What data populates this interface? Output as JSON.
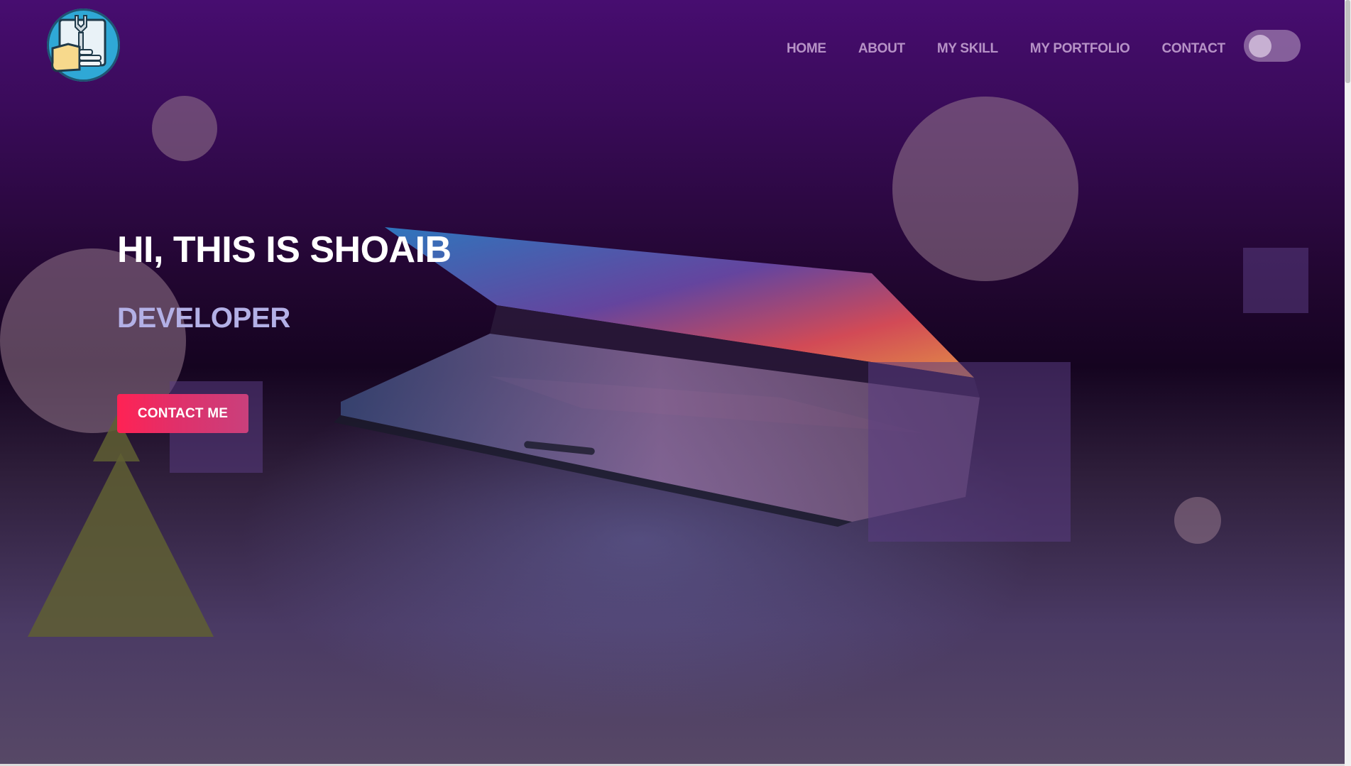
{
  "header": {
    "logo_icon": "wrench-hand-logo-icon",
    "nav": [
      {
        "label": "HOME"
      },
      {
        "label": "ABOUT"
      },
      {
        "label": "MY SKILL"
      },
      {
        "label": "MY PORTFOLIO"
      },
      {
        "label": "CONTACT"
      }
    ],
    "theme_toggle": {
      "icon": "toggle-switch",
      "state": "off"
    }
  },
  "hero": {
    "title": "HI, THIS IS SHOAIB",
    "subtitle": "DEVELOPER",
    "cta_label": "CONTACT ME",
    "background_image": "laptop-photo"
  },
  "colors": {
    "accent": "#ff2254",
    "subtitle": "#b3b0e6",
    "top_gradient": "#470d70"
  }
}
